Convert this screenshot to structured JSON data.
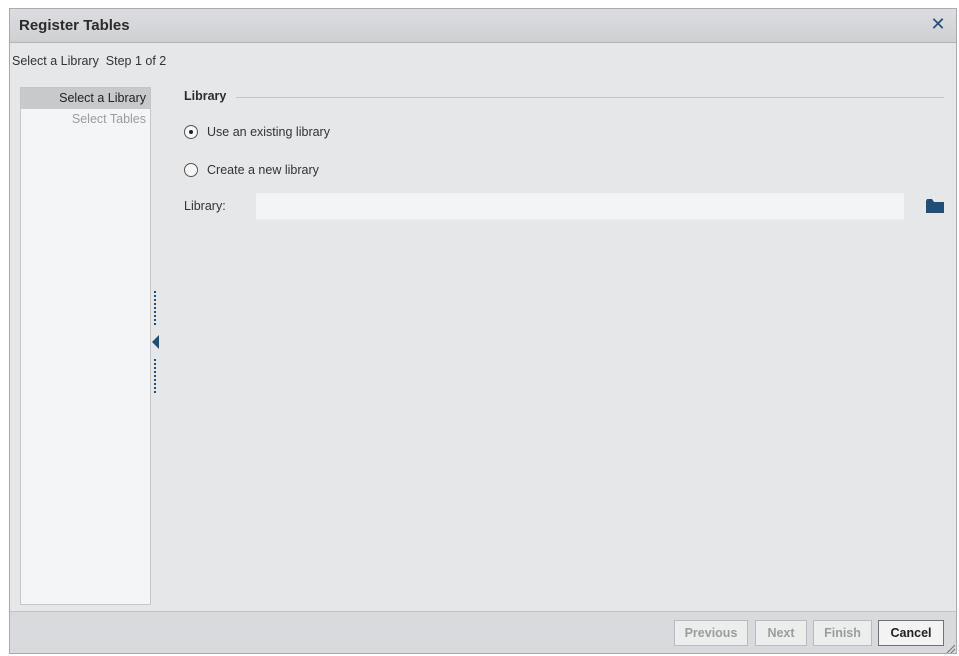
{
  "dialog": {
    "title": "Register Tables",
    "close_icon": "close-icon"
  },
  "step": {
    "text": "Select a Library  Step 1 of 2"
  },
  "nav": {
    "items": [
      {
        "label": "Select a Library",
        "active": true
      },
      {
        "label": "Select Tables",
        "active": false
      }
    ]
  },
  "section": {
    "title": "Library"
  },
  "options": {
    "existing_label": "Use an existing library",
    "new_label": "Create a new library",
    "selected": "existing"
  },
  "library_field": {
    "label": "Library:",
    "value": "",
    "icon": "folder-icon"
  },
  "footer": {
    "previous_label": "Previous",
    "next_label": "Next",
    "finish_label": "Finish",
    "cancel_label": "Cancel"
  },
  "colors": {
    "accent": "#1f4e79",
    "dialog_bg": "#e6e7e9",
    "titlebar_bg": "#d4d5d8"
  }
}
